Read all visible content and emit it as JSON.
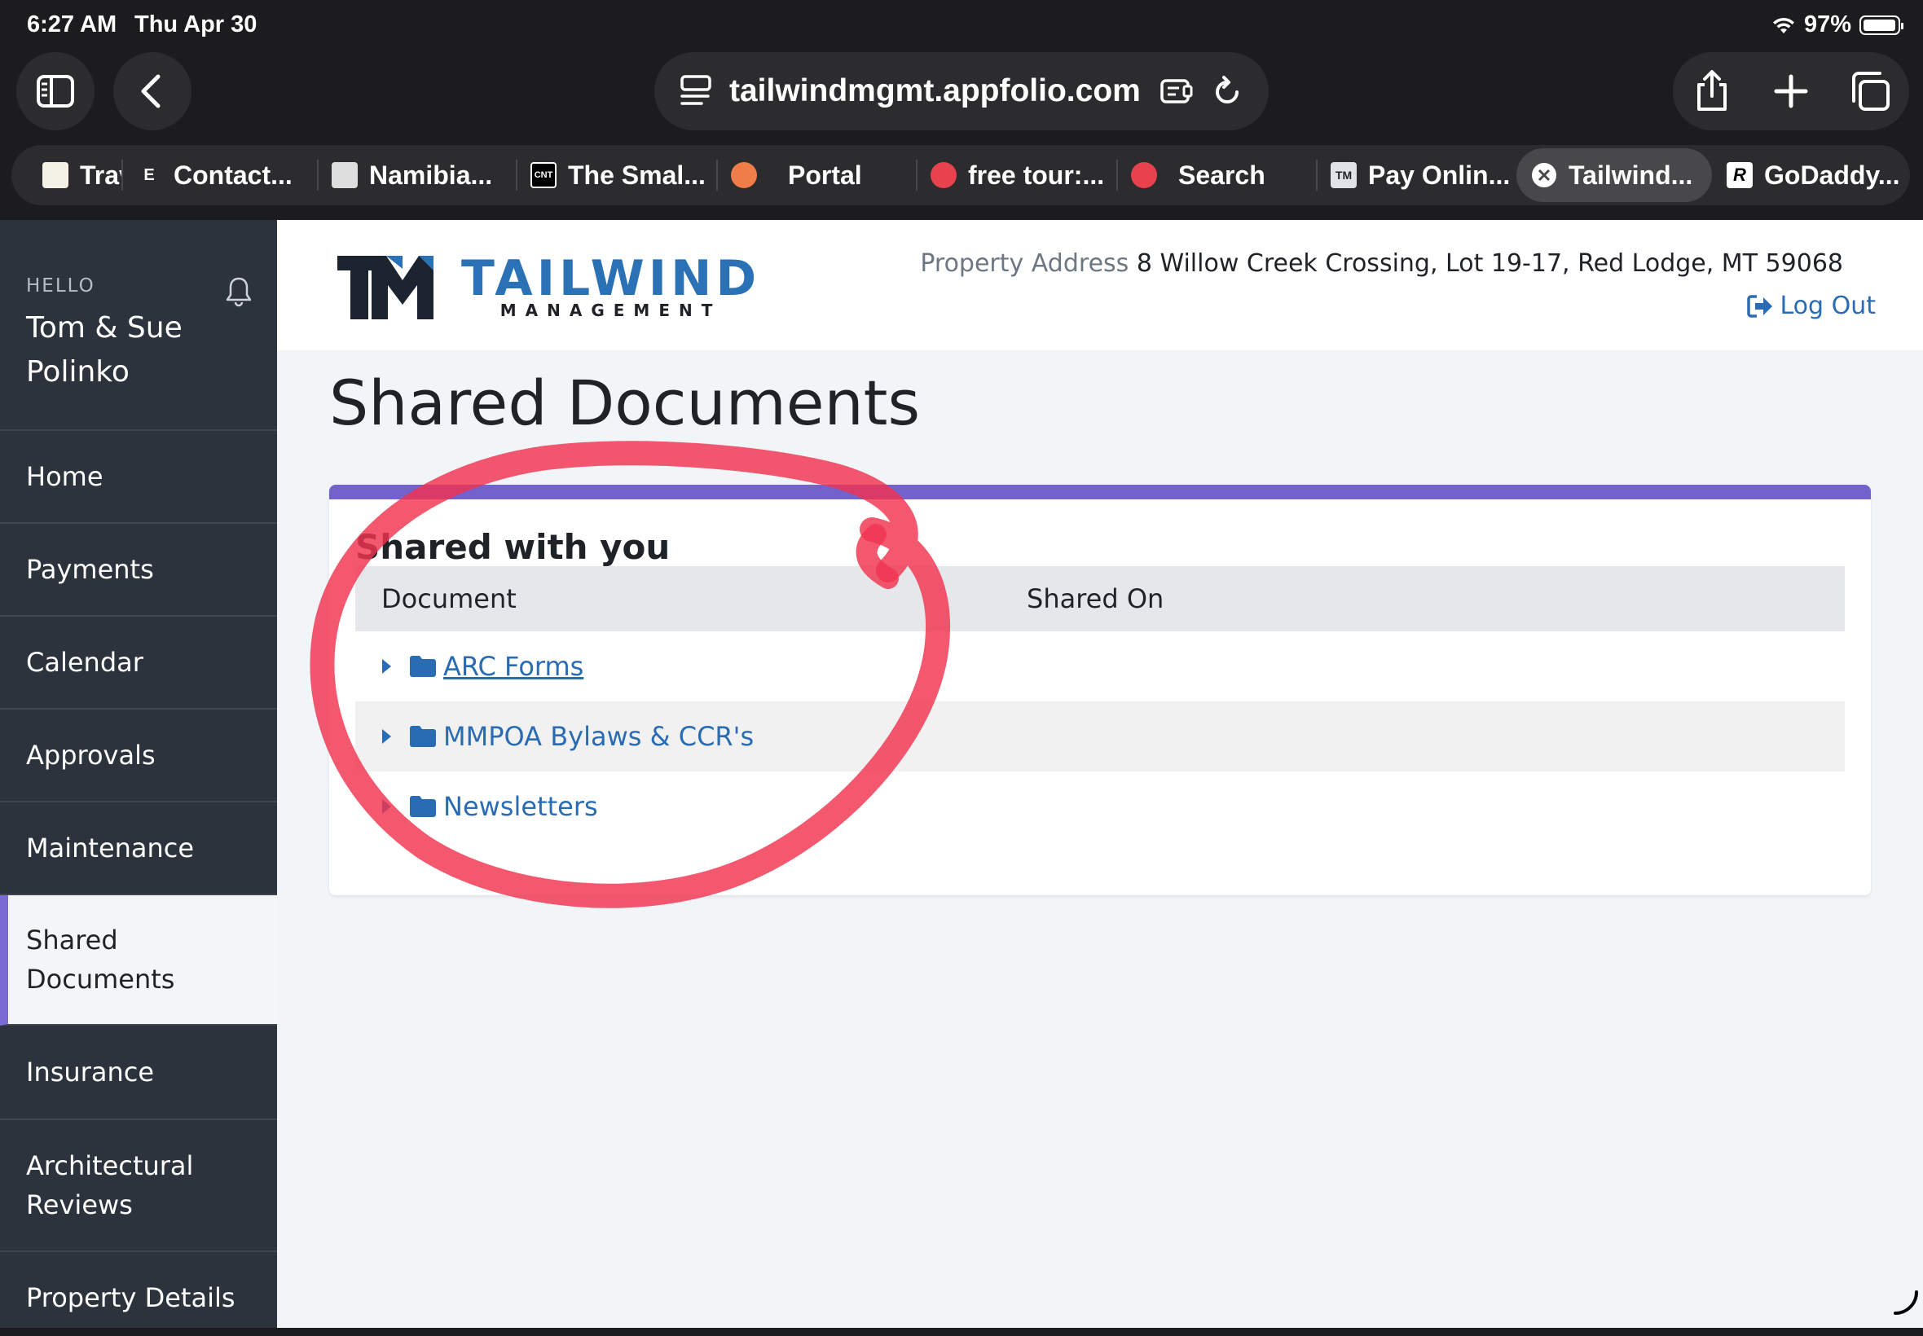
{
  "status_bar": {
    "time": "6:27 AM",
    "date": "Thu Apr 30",
    "battery": "97%",
    "battery_level": 0.97
  },
  "browser": {
    "url": "tailwindmgmt.appfolio.com",
    "tabs": [
      {
        "label": "Trav",
        "favicon": "travel-logo-icon"
      },
      {
        "label": "Contact...",
        "favicon": "letter-e-icon",
        "favicon_text": "E"
      },
      {
        "label": "Namibia...",
        "favicon": "namibia-logo-icon"
      },
      {
        "label": "The Smal...",
        "favicon": "cnt-logo-icon",
        "favicon_text": "CNT"
      },
      {
        "label": "Portal",
        "favicon": "bike-icon"
      },
      {
        "label": "free tour:...",
        "favicon": "globe-icon"
      },
      {
        "label": "Search",
        "favicon": "globe-icon"
      },
      {
        "label": "Pay Onlin...",
        "favicon": "tm-logo-icon"
      },
      {
        "label": "Tailwind...",
        "favicon": "close-icon",
        "active": true
      },
      {
        "label": "GoDaddy...",
        "favicon": "godaddy-icon"
      }
    ]
  },
  "sidebar": {
    "hello": "HELLO",
    "user_name": "Tom & Sue Polinko",
    "items": [
      {
        "label": "Home"
      },
      {
        "label": "Payments"
      },
      {
        "label": "Calendar"
      },
      {
        "label": "Approvals"
      },
      {
        "label": "Maintenance"
      },
      {
        "label": "Shared Documents",
        "active": true
      },
      {
        "label": "Insurance"
      },
      {
        "label": "Architectural Reviews"
      },
      {
        "label": "Property Details"
      }
    ]
  },
  "header": {
    "logo_word": "TAILWIND",
    "logo_sub": "MANAGEMENT",
    "address_label": "Property Address",
    "address": "8 Willow Creek Crossing, Lot 19-17, Red Lodge, MT 59068",
    "logout": "Log Out"
  },
  "page": {
    "title": "Shared Documents",
    "card_title": "Shared with you",
    "columns": {
      "document": "Document",
      "shared_on": "Shared On"
    },
    "folders": [
      {
        "name": "ARC Forms",
        "shared_on": ""
      },
      {
        "name": "MMPOA Bylaws & CCR's",
        "shared_on": ""
      },
      {
        "name": "Newsletters",
        "shared_on": ""
      }
    ]
  },
  "colors": {
    "accent_purple": "#7362cc",
    "link_blue": "#2a6cb3",
    "brand_blue": "#2a72b5",
    "sidebar_bg": "#2d333d",
    "annotation_red": "#f0334f"
  }
}
